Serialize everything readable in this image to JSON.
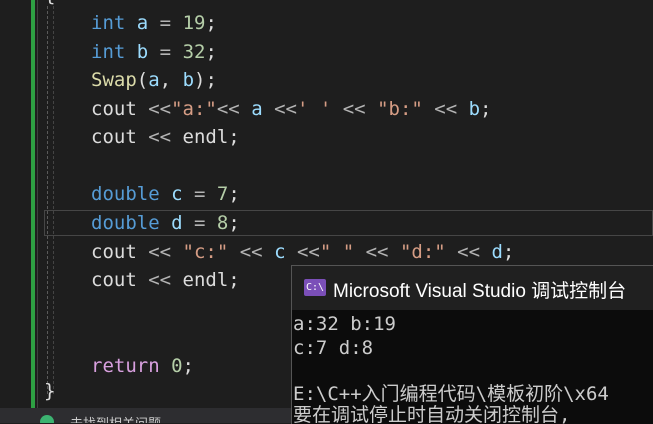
{
  "editor": {
    "open_brace": "{",
    "close_brace": "}",
    "lines": {
      "l1": {
        "kw": "int",
        "var": "a",
        "op": " = ",
        "num": "19",
        "end": ";"
      },
      "l2": {
        "kw": "int",
        "var": "b",
        "op": " = ",
        "num": "32",
        "end": ";"
      },
      "l3": {
        "fn": "Swap",
        "open": "(",
        "a": "a",
        "sep": ", ",
        "b": "b",
        "close": ");"
      },
      "l4": {
        "cout": "cout",
        "p1": " <<",
        "s1": "\"a:\"",
        "p2": "<< ",
        "a": "a",
        "p3": " <<",
        "s2": "' '",
        "p4": " << ",
        "s3": "\"b:\"",
        "p5": " << ",
        "b": "b",
        "end": ";"
      },
      "l5": {
        "cout": "cout",
        "p1": " << ",
        "endl": "endl",
        "end": ";"
      },
      "l6": {
        "kw": "double",
        "var": "c",
        "op": " = ",
        "num": "7",
        "end": ";"
      },
      "l7": {
        "kw": "double",
        "var": "d",
        "op": " = ",
        "num": "8",
        "end": ";"
      },
      "l8": {
        "cout": "cout",
        "p1": " << ",
        "s1": "\"c:\"",
        "p2": " << ",
        "c": "c",
        "p3": " <<",
        "s2": "\" \"",
        "p4": " << ",
        "s3": "\"d:\"",
        "p5": " << ",
        "d": "d",
        "end": ";"
      },
      "l9": {
        "cout": "cout",
        "p1": " << ",
        "endl": "endl",
        "end": ";"
      },
      "l10": {
        "kw": "return",
        "sp": " ",
        "num": "0",
        "end": ";"
      }
    }
  },
  "status_bar": {
    "text": "未找到相关问题"
  },
  "console": {
    "icon_text": "C:\\",
    "title": "Microsoft Visual Studio 调试控制台",
    "output": [
      "a:32 b:19",
      "c:7 d:8",
      "",
      "E:\\C++入门编程代码\\模板初阶\\x64",
      "要在调试停止时自动关闭控制台,"
    ]
  },
  "colors": {
    "keyword": "#569cd6",
    "function": "#dcdcaa",
    "variable": "#9cdcfe",
    "number": "#b5cea8",
    "string": "#d69d85",
    "change_bar": "#2ea043"
  }
}
